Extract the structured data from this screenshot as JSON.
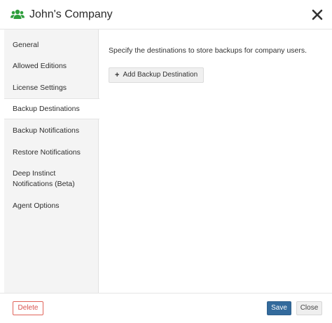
{
  "header": {
    "title": "John's Company",
    "icon": "users-icon",
    "close_icon": "close-icon",
    "accent_color": "#2e9e3c"
  },
  "sidebar": {
    "items": [
      {
        "label": "General",
        "active": false
      },
      {
        "label": "Allowed Editions",
        "active": false
      },
      {
        "label": "License Settings",
        "active": false
      },
      {
        "label": "Backup Destinations",
        "active": true
      },
      {
        "label": "Backup Notifications",
        "active": false
      },
      {
        "label": "Restore Notifications",
        "active": false
      },
      {
        "label": "Deep Instinct\nNotifications (Beta)",
        "active": false
      },
      {
        "label": "Agent Options",
        "active": false
      }
    ]
  },
  "main": {
    "description": "Specify the destinations to store backups for company users.",
    "add_button_label": "Add Backup Destination",
    "add_button_icon": "plus-icon"
  },
  "footer": {
    "delete_label": "Delete",
    "save_label": "Save",
    "close_label": "Close",
    "delete_color": "#d9534f",
    "save_color": "#336a9c"
  }
}
